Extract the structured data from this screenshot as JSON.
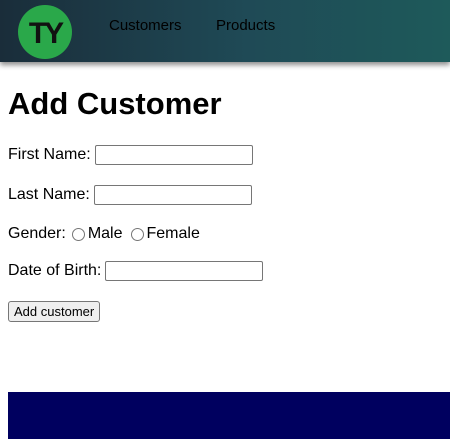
{
  "header": {
    "logo_text": "TY",
    "nav": {
      "customers": "Customers",
      "products": "Products"
    },
    "colors": {
      "bar_start": "#1a2d3a",
      "bar_end": "#1e5a5a",
      "logo_bg": "#2aa84a",
      "logo_fg": "#111111"
    }
  },
  "form": {
    "title": "Add Customer",
    "first_name_label": "First Name:",
    "first_name_value": "",
    "last_name_label": "Last Name:",
    "last_name_value": "",
    "gender_label": "Gender:",
    "gender_options": [
      "Male",
      "Female"
    ],
    "gender_selected": null,
    "dob_label": "Date of Birth:",
    "dob_value": "",
    "submit_label": "Add customer"
  },
  "footer": {
    "color": "#00005f"
  }
}
